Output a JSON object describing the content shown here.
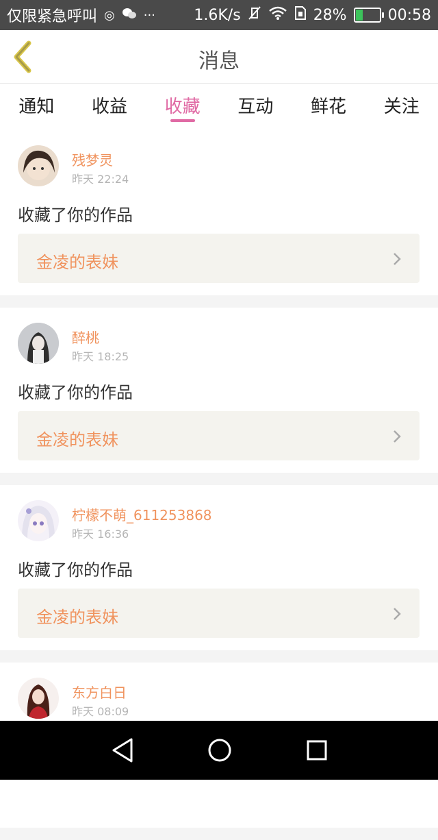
{
  "status_bar": {
    "carrier": "仅限紧急呼叫",
    "speed": "1.6K/s",
    "battery": "28%",
    "battery_level": 0.28,
    "time": "00:58",
    "more": "···",
    "icons": [
      "nfc-icon",
      "wechat-icon",
      "mute-icon",
      "wifi-icon",
      "sim-icon",
      "battery-charging-icon"
    ]
  },
  "header": {
    "title": "消息"
  },
  "tabs": [
    {
      "label": "通知",
      "active": false
    },
    {
      "label": "收益",
      "active": false
    },
    {
      "label": "收藏",
      "active": true
    },
    {
      "label": "互动",
      "active": false
    },
    {
      "label": "鲜花",
      "active": false
    },
    {
      "label": "关注",
      "active": false
    }
  ],
  "messages": [
    {
      "user": "残梦灵",
      "time": "昨天 22:24",
      "action": "收藏了你的作品",
      "work": "金凌的表妹"
    },
    {
      "user": "醉桃",
      "time": "昨天 18:25",
      "action": "收藏了你的作品",
      "work": "金凌的表妹"
    },
    {
      "user": "柠檬不萌_611253868",
      "time": "昨天 16:36",
      "action": "收藏了你的作品",
      "work": "金凌的表妹"
    },
    {
      "user": "东方白日",
      "time": "昨天 08:09",
      "action": "",
      "work": ""
    }
  ],
  "colors": {
    "accent": "#e06aa4",
    "username": "#f0935e",
    "back_arrow": "#d9c64a"
  }
}
